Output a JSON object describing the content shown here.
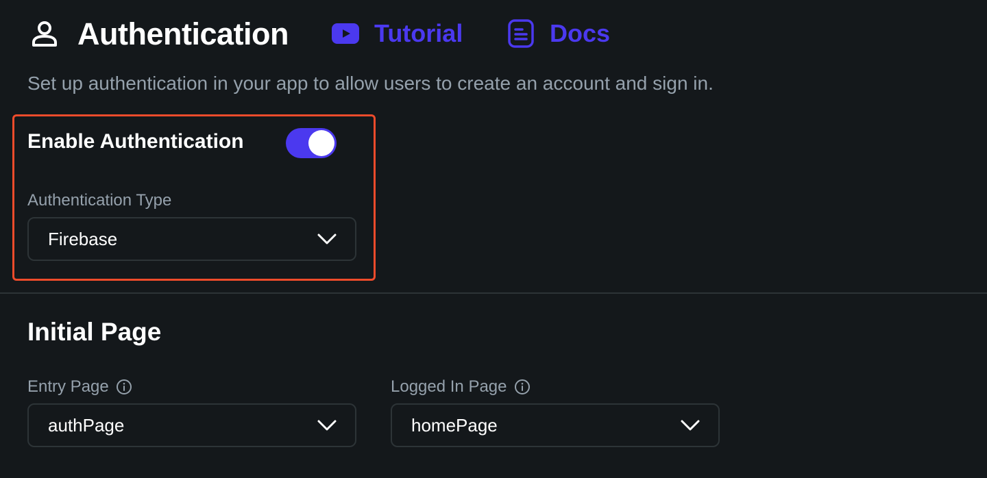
{
  "header": {
    "title": "Authentication",
    "title_icon": "user-icon",
    "links": [
      {
        "label": "Tutorial",
        "icon": "youtube-play-icon"
      },
      {
        "label": "Docs",
        "icon": "document-icon"
      }
    ]
  },
  "subtitle": "Set up authentication in your app to allow users to create an account and sign in.",
  "auth_settings": {
    "enable_label": "Enable Authentication",
    "enabled": true,
    "type_label": "Authentication Type",
    "type_value": "Firebase"
  },
  "initial_page": {
    "title": "Initial Page",
    "entry_page": {
      "label": "Entry Page",
      "value": "authPage"
    },
    "logged_in_page": {
      "label": "Logged In Page",
      "value": "homePage"
    }
  },
  "colors": {
    "background": "#14181b",
    "accent": "#4b39ef",
    "highlight": "#ee4b2b",
    "secondary_text": "#95a1ac",
    "border": "#2d3437"
  }
}
